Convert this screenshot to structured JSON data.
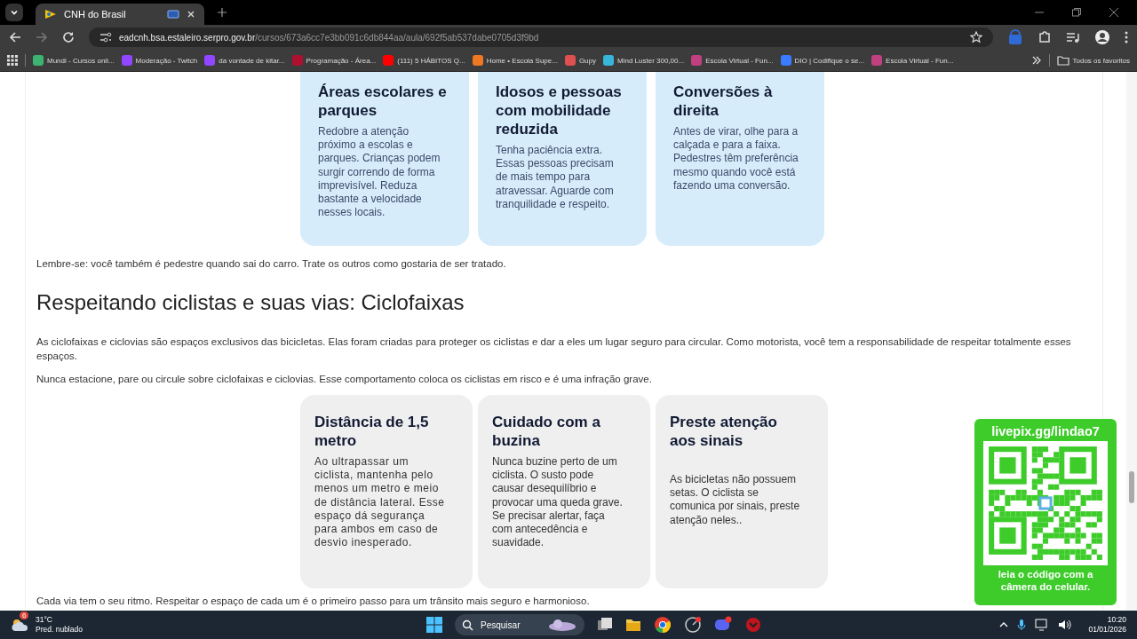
{
  "browser": {
    "tabs": [
      {
        "title": "CNH do Brasil",
        "selected": true
      }
    ],
    "address": {
      "host": "eadcnh.bsa.estaleiro.serpro.gov.br",
      "path": "/cursos/673a6cc7e3bb091c6db844aa/aula/692f5ab537dabe0705d3f9bd"
    },
    "bookmarks": [
      {
        "label": "Mundi - Cursos onli...",
        "color": "#3cb371"
      },
      {
        "label": "Moderação - Twitch",
        "color": "#9146ff"
      },
      {
        "label": "da vontade de kitar...",
        "color": "#9146ff"
      },
      {
        "label": "Programação - Área...",
        "color": "#b01030"
      },
      {
        "label": "(111) 5 HÁBITOS Q...",
        "color": "#ff0000"
      },
      {
        "label": "Home • Escola Supe...",
        "color": "#f07820"
      },
      {
        "label": "Gupy",
        "color": "#e05050"
      },
      {
        "label": "Mind Luster 300,00...",
        "color": "#38b6d8"
      },
      {
        "label": "Escola Virtual - Fun...",
        "color": "#c04080"
      },
      {
        "label": "DIO | Codifique o se...",
        "color": "#3a7bff"
      },
      {
        "label": "Escola Virtual - Fun...",
        "color": "#c04080"
      }
    ],
    "all_bookmarks": "Todos os favoritos"
  },
  "page": {
    "cards_top": [
      {
        "title": "Áreas escolares e parques",
        "text": "Redobre a atenção próximo a escolas e parques. Crianças podem surgir correndo de forma imprevisível. Reduza bastante a velocidade nesses locais."
      },
      {
        "title": "Idosos e pessoas com mobilidade reduzida",
        "text": "Tenha paciência extra. Essas pessoas precisam de mais tempo para atravessar. Aguarde com tranquilidade e respeito."
      },
      {
        "title": "Conversões à direita",
        "text": "Antes de virar, olhe para a calçada e para a faixa. Pedestres têm preferência mesmo quando você está fazendo uma conversão."
      }
    ],
    "reminder": "Lembre-se: você também é pedestre quando sai do carro. Trate os outros como gostaria de ser tratado.",
    "heading": "Respeitando ciclistas e suas vias: Ciclofaixas",
    "paragraphs": [
      "As ciclofaixas e ciclovias são espaços exclusivos das bicicletas. Elas foram criadas para proteger os ciclistas e dar a eles um lugar seguro para circular. Como motorista, você tem a responsabilidade de respeitar totalmente esses espaços.",
      "Nunca estacione, pare ou circule sobre ciclofaixas e ciclovias. Esse comportamento coloca os ciclistas em risco e é uma infração grave."
    ],
    "cards_bottom": [
      {
        "title": "Distância de 1,5 metro",
        "text": "Ao ultrapassar um ciclista, mantenha pelo menos um metro e meio de distância lateral. Esse espaço dá segurança para ambos em caso de desvio inesperado."
      },
      {
        "title": "Cuidado com a buzina",
        "text": "Nunca buzine perto de um ciclista. O susto pode causar desequilíbrio e provocar uma queda grave. Se precisar alertar, faça com antecedência e suavidade."
      },
      {
        "title": "Preste atenção aos sinais",
        "text": "As bicicletas não possuem setas. O ciclista se comunica por sinais, preste atenção neles.."
      }
    ],
    "closing": "Cada via tem o seu ritmo. Respeitar o espaço de cada um é o primeiro passo para um trânsito mais seguro e harmonioso."
  },
  "overlay": {
    "link": "livepix.gg/lindao7",
    "caption": "leia o código com a câmera do celular."
  },
  "taskbar": {
    "temperature": "31°C",
    "weather": "Pred. nublado",
    "weather_badge": "6",
    "search": "Pesquisar",
    "time": "10:20",
    "date": "01/01/2026"
  }
}
